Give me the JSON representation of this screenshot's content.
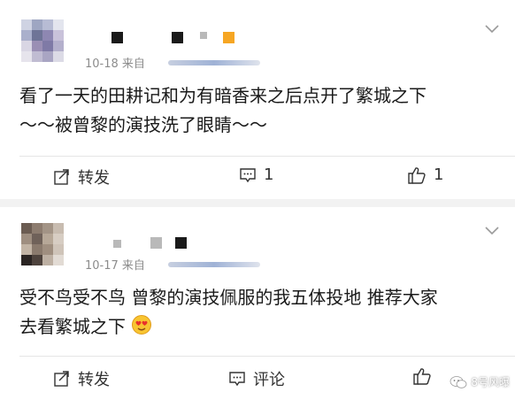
{
  "comments": [
    {
      "meta_prefix": "10-18 来自",
      "content_lines": [
        "看了一天的田耕记和为有暗香来之后点开了繁城之下",
        "～～被曾黎的演技洗了眼睛～～"
      ],
      "actions": {
        "repost": "转发",
        "comment_count": "1",
        "like_count": "1"
      }
    },
    {
      "meta_prefix": "10-17 来自",
      "content_lines": [
        "受不鸟受不鸟 曾黎的演技佩服的我五体投地 推荐大家",
        "去看繁城之下"
      ],
      "actions": {
        "repost": "转发",
        "comment": "评论"
      }
    }
  ],
  "watermark": {
    "text": "8号风曝"
  },
  "colors": {
    "text": "#1a1a1a",
    "meta": "#8c8c8c",
    "background": "#f2f2f2",
    "card": "#ffffff"
  }
}
